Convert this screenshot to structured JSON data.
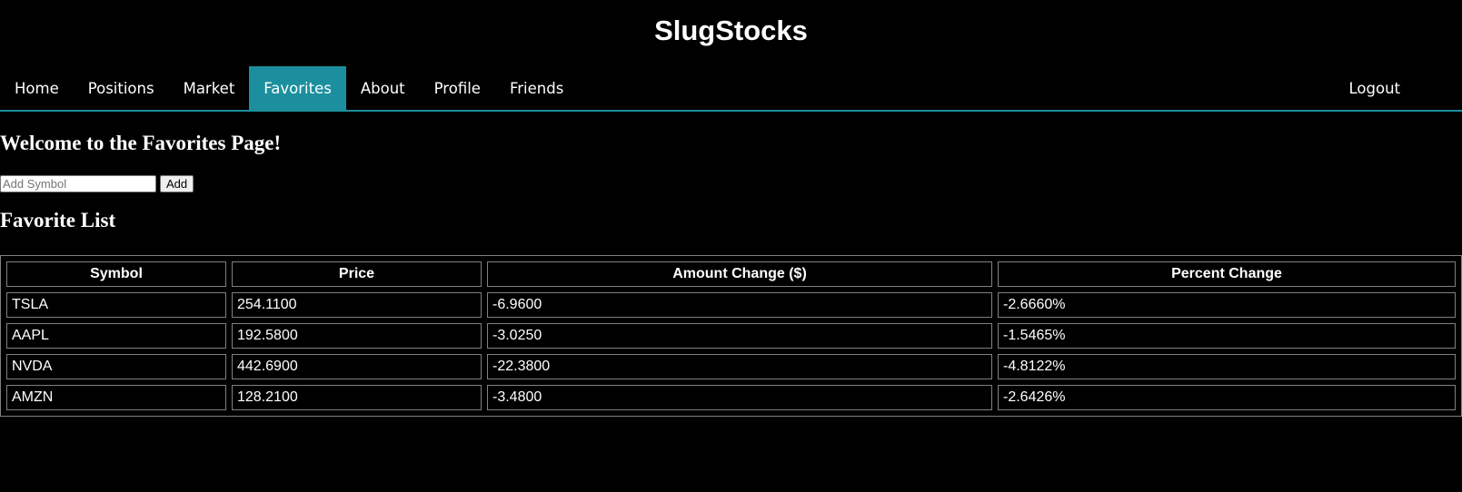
{
  "app": {
    "title": "SlugStocks"
  },
  "nav": {
    "items": [
      {
        "label": "Home"
      },
      {
        "label": "Positions"
      },
      {
        "label": "Market"
      },
      {
        "label": "Favorites"
      },
      {
        "label": "About"
      },
      {
        "label": "Profile"
      },
      {
        "label": "Friends"
      }
    ],
    "active": "Favorites",
    "logout_label": "Logout"
  },
  "page": {
    "welcome": "Welcome to the Favorites Page!",
    "add_placeholder": "Add Symbol",
    "add_value": "",
    "add_button": "Add",
    "list_title": "Favorite List"
  },
  "colors": {
    "accent": "#1b8f9e",
    "background": "#000000",
    "text": "#ffffff"
  },
  "table": {
    "headers": [
      "Symbol",
      "Price",
      "Amount Change ($)",
      "Percent Change"
    ],
    "rows": [
      [
        "TSLA",
        "254.1100",
        "-6.9600",
        "-2.6660%"
      ],
      [
        "AAPL",
        "192.5800",
        "-3.0250",
        "-1.5465%"
      ],
      [
        "NVDA",
        "442.6900",
        "-22.3800",
        "-4.8122%"
      ],
      [
        "AMZN",
        "128.2100",
        "-3.4800",
        "-2.6426%"
      ]
    ]
  }
}
